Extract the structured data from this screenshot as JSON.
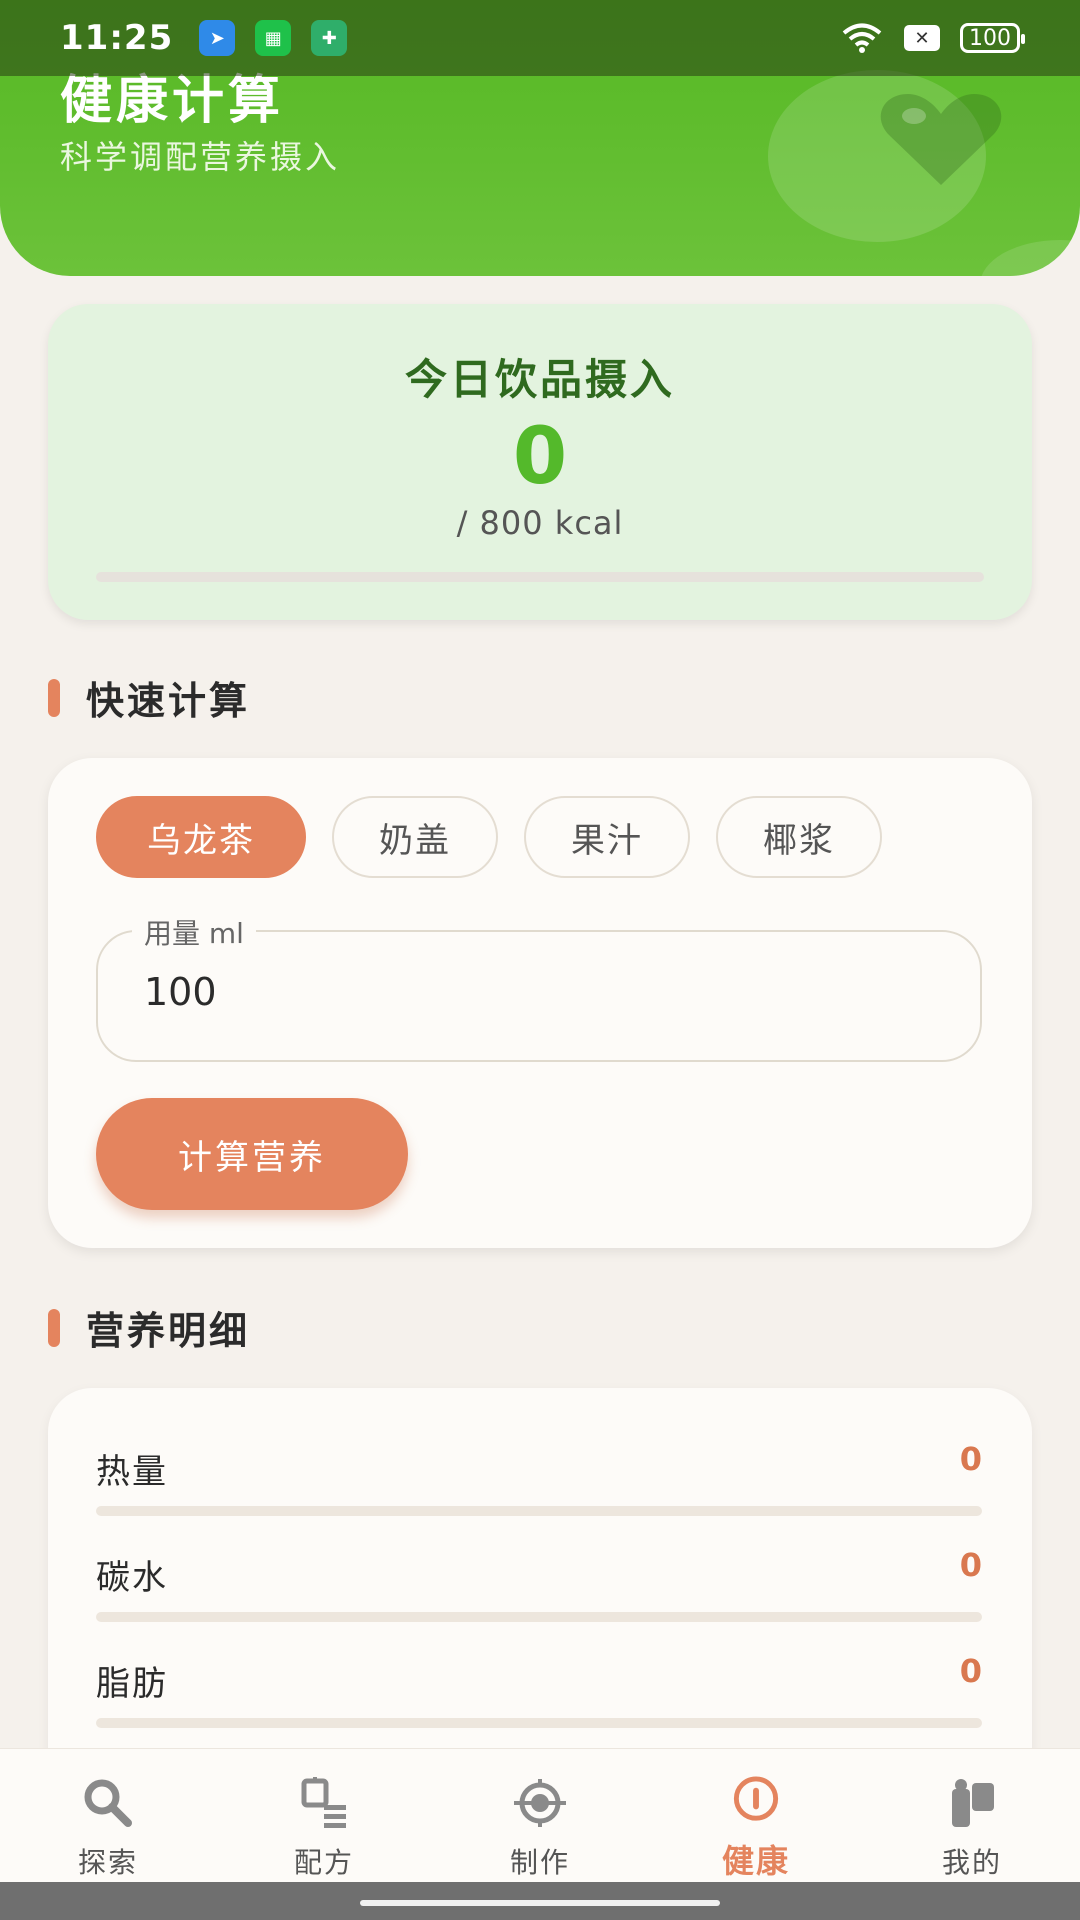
{
  "status_bar": {
    "time": "11:25",
    "battery": "100"
  },
  "header": {
    "title": "健康计算",
    "subtitle": "科学调配营养摄入"
  },
  "summary": {
    "title": "今日饮品摄入",
    "value": "0",
    "target": "/ 800 kcal",
    "progress": 0
  },
  "quick_calc": {
    "heading": "快速计算",
    "chips": [
      "乌龙茶",
      "奶盖",
      "果汁",
      "椰浆"
    ],
    "selected_chip": "乌龙茶",
    "amount_label": "用量 ml",
    "amount_value": "100",
    "button_label": "计算营养"
  },
  "nutrition": {
    "heading": "营养明细",
    "rows": [
      {
        "label": "热量",
        "value": "0",
        "progress": 0
      },
      {
        "label": "碳水",
        "value": "0",
        "progress": 0
      },
      {
        "label": "脂肪",
        "value": "0",
        "progress": 0
      }
    ]
  },
  "bottom_nav": {
    "items": [
      {
        "label": "探索",
        "icon": "search-icon"
      },
      {
        "label": "配方",
        "icon": "recipe-icon"
      },
      {
        "label": "制作",
        "icon": "make-icon"
      },
      {
        "label": "健康",
        "icon": "health-icon",
        "active": true
      },
      {
        "label": "我的",
        "icon": "profile-icon"
      }
    ]
  },
  "colors": {
    "brand_green": "#55b823",
    "accent_orange": "#e4845e",
    "background": "#f5f1ec"
  }
}
